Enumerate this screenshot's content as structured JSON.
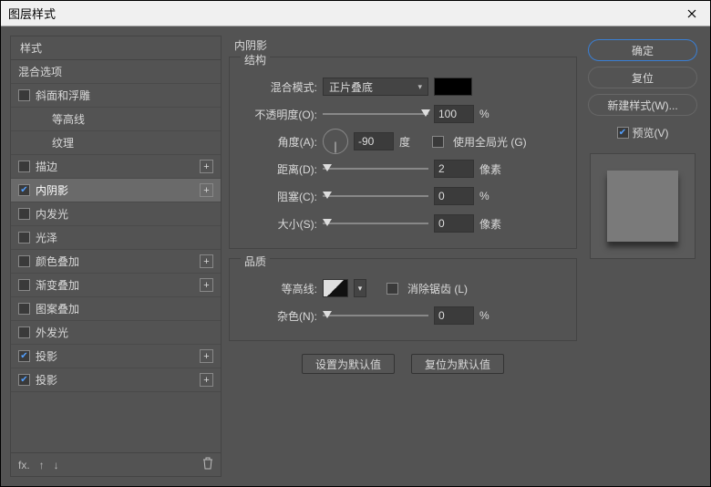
{
  "window": {
    "title": "图层样式"
  },
  "left": {
    "header": "样式",
    "blending_options": "混合选项",
    "items": [
      {
        "label": "斜面和浮雕",
        "checked": false,
        "plus": false,
        "indent": 0
      },
      {
        "label": "等高线",
        "checked": null,
        "plus": false,
        "indent": 1
      },
      {
        "label": "纹理",
        "checked": null,
        "plus": false,
        "indent": 1
      },
      {
        "label": "描边",
        "checked": false,
        "plus": true,
        "indent": 0
      },
      {
        "label": "内阴影",
        "checked": true,
        "plus": true,
        "indent": 0,
        "selected": true
      },
      {
        "label": "内发光",
        "checked": false,
        "plus": false,
        "indent": 0
      },
      {
        "label": "光泽",
        "checked": false,
        "plus": false,
        "indent": 0
      },
      {
        "label": "颜色叠加",
        "checked": false,
        "plus": true,
        "indent": 0
      },
      {
        "label": "渐变叠加",
        "checked": false,
        "plus": true,
        "indent": 0
      },
      {
        "label": "图案叠加",
        "checked": false,
        "plus": false,
        "indent": 0
      },
      {
        "label": "外发光",
        "checked": false,
        "plus": false,
        "indent": 0
      },
      {
        "label": "投影",
        "checked": true,
        "plus": true,
        "indent": 0
      },
      {
        "label": "投影",
        "checked": true,
        "plus": true,
        "indent": 0
      }
    ]
  },
  "center": {
    "effect_title": "内阴影",
    "structure_title": "结构",
    "blend_mode_label": "混合模式:",
    "blend_mode_value": "正片叠底",
    "opacity_label": "不透明度(O):",
    "opacity_value": "100",
    "percent": "%",
    "angle_label": "角度(A):",
    "angle_value": "-90",
    "degree": "度",
    "use_global_light": "使用全局光 (G)",
    "distance_label": "距离(D):",
    "distance_value": "2",
    "pixels": "像素",
    "choke_label": "阻塞(C):",
    "choke_value": "0",
    "size_label": "大小(S):",
    "size_value": "0",
    "quality_title": "品质",
    "contour_label": "等高线:",
    "antialias": "消除锯齿 (L)",
    "noise_label": "杂色(N):",
    "noise_value": "0",
    "set_default": "设置为默认值",
    "reset_default": "复位为默认值"
  },
  "right": {
    "ok": "确定",
    "reset": "复位",
    "new_style": "新建样式(W)...",
    "preview": "预览(V)"
  }
}
